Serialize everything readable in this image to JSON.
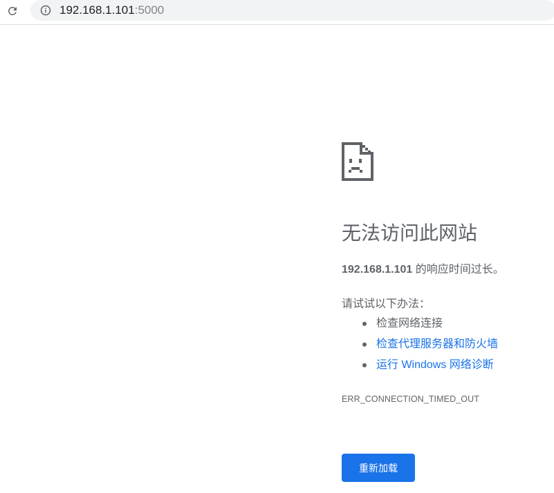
{
  "browser": {
    "url_host": "192.168.1.101",
    "url_port": ":5000",
    "reload_icon": "reload-icon",
    "info_icon": "info-icon"
  },
  "error_page": {
    "icon": "sad-page-icon",
    "title": "无法访问此网站",
    "host": "192.168.1.101",
    "description_suffix": " 的响应时间过长。",
    "try_label": "请试试以下办法：",
    "suggestions": [
      {
        "label": "检查网络连接",
        "link": false
      },
      {
        "label": "检查代理服务器和防火墙",
        "link": true
      },
      {
        "label": "运行 Windows 网络诊断",
        "link": true
      }
    ],
    "error_code": "ERR_CONNECTION_TIMED_OUT",
    "reload_label": "重新加载"
  },
  "colors": {
    "accent": "#1a73e8",
    "text": "#5f6368"
  }
}
